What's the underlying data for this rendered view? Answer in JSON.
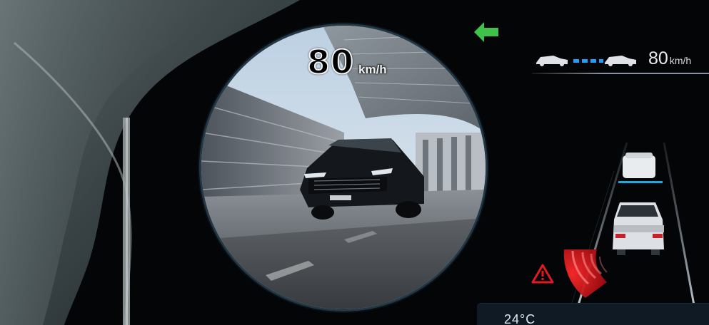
{
  "bvm": {
    "speed_value": "80",
    "speed_unit": "km/h"
  },
  "cruise": {
    "speed_value": "80",
    "speed_unit": "km/h"
  },
  "panel": {
    "value": "24°C"
  },
  "colors": {
    "turn_signal": "#3fc24a",
    "warning_red": "#e11a22",
    "lane_blue": "#22a7e0",
    "gap_blue": "#1aa0ff"
  },
  "icons": [
    "turn-left-arrow-icon",
    "warning-triangle-icon",
    "car-icon",
    "blind-spot-wave-icon"
  ]
}
